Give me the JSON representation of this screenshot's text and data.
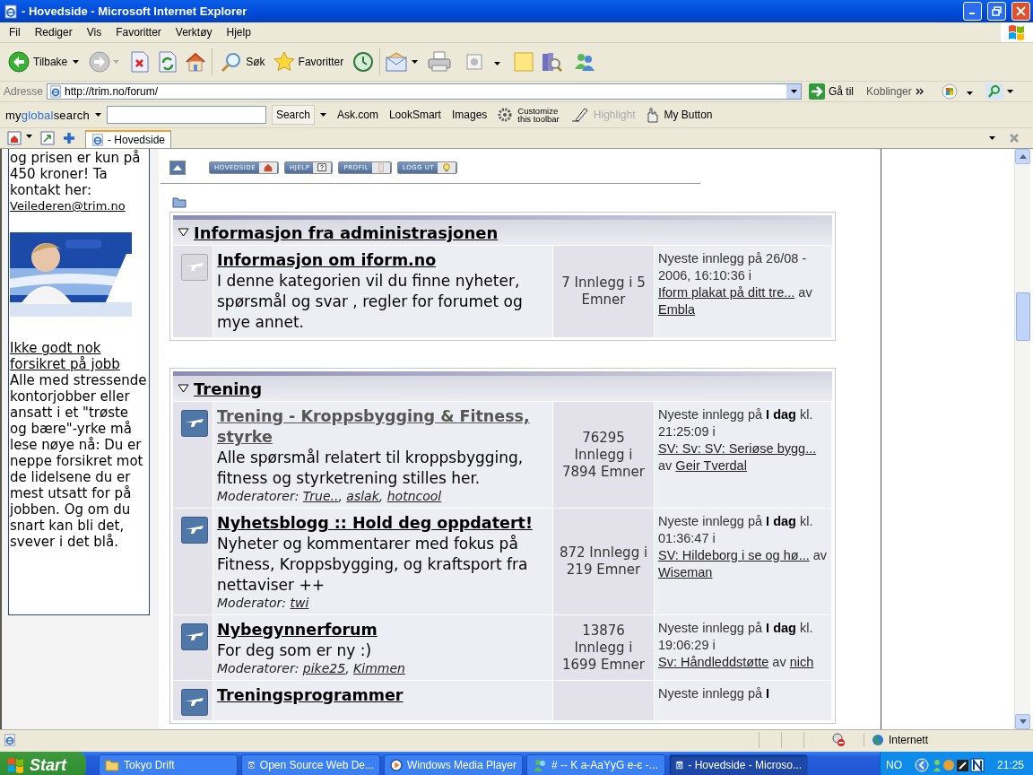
{
  "window": {
    "title": "- Hovedside - Microsoft Internet Explorer"
  },
  "menu": [
    "Fil",
    "Rediger",
    "Vis",
    "Favoritter",
    "Verktøy",
    "Hjelp"
  ],
  "toolbar": {
    "back": "Tilbake",
    "search": "Søk",
    "favorites": "Favoritter"
  },
  "address": {
    "label": "Adresse",
    "value": "http://trim.no/forum/",
    "go": "Gå til",
    "links": "Koblinger"
  },
  "search_toolbar": {
    "brand": [
      "my",
      "global",
      "search"
    ],
    "button": "Search",
    "links": [
      "Ask.com",
      "LookSmart",
      "Images"
    ],
    "customize": [
      "Customize",
      "this toolbar"
    ],
    "highlight": {
      "label": "Highlight",
      "disabled": true
    },
    "my_button": "My Button"
  },
  "tabs": [
    {
      "label": "- Hovedside",
      "selected": true
    }
  ],
  "sidebar": {
    "intro": "og prisen er kun på 450 kroner! Ta kontakt her:",
    "email": "Veilederen@trim.no",
    "article_link": "Ikke godt nok forsikret på jobb",
    "article_text": "Alle med stressende kontorjobber eller ansatt i et \"trøste og bære\"-yrke må lese nøye nå: Du er neppe forsikret mot de lidelsene du er mest utsatt for på jobben. Og om du snart kan bli det, svever i det blå."
  },
  "forum_nav": [
    "HOVEDSIDE",
    "HJELP",
    "PROFIL",
    "LOGG UT"
  ],
  "list_separator": ", ",
  "categories": [
    {
      "title": "Informasjon fra administrasjonen",
      "expanded": true,
      "forums": [
        {
          "title": "Informasjon om iform.no",
          "visited": false,
          "new_posts": false,
          "description": "I denne kategorien vil du finne nyheter, spørsmål og svar , regler for forumet og mye annet.",
          "stats": "7 Innlegg i 5 Emner",
          "last_post": {
            "text": "Nyeste innlegg på 26/08 - 2006, 16:10:36",
            "in_label": "i",
            "topic": "Iform plakat på ditt tre...",
            "by_label": "av",
            "author": "Embla"
          }
        }
      ]
    },
    {
      "title": "Trening",
      "expanded": true,
      "forums": [
        {
          "title": "Trening - Kroppsbygging & Fitness, styrke",
          "visited": true,
          "new_posts": true,
          "description": "Alle spørsmål relatert til kroppsbygging, fitness og styrketrening stilles her.",
          "moderators": {
            "label": "Moderatorer:",
            "names": [
              "True..",
              "aslak",
              "hotncool"
            ]
          },
          "stats": "76295 Innlegg i 7894 Emner",
          "last_post": {
            "text": "Nyeste innlegg på **I dag** kl. 21:25:09",
            "in_label": "i",
            "topic": "SV: Sv: SV: Seriøse bygg...",
            "by_label": "av",
            "author": "Geir Tverdal"
          }
        },
        {
          "title": "Nyhetsblogg :: Hold deg oppdatert!",
          "visited": false,
          "new_posts": true,
          "description": "Nyheter og kommentarer med fokus på Fitness, Kroppsbygging, og kraftsport fra nettaviser ++",
          "moderators": {
            "label": "Moderator:",
            "names": [
              "twi"
            ]
          },
          "stats": "872 Innlegg i 219 Emner",
          "last_post": {
            "text": "Nyeste innlegg på **I dag** kl. 01:36:47",
            "in_label": "i",
            "topic": "SV: Hildeborg i se og hø...",
            "by_label": "av",
            "author": "Wiseman"
          }
        },
        {
          "title": "Nybegynnerforum",
          "visited": false,
          "new_posts": true,
          "description": "For deg som er ny :)",
          "moderators": {
            "label": "Moderatorer:",
            "names": [
              "pike25",
              "Kimmen"
            ]
          },
          "stats": "13876 Innlegg i 1699 Emner",
          "last_post": {
            "text": "Nyeste innlegg på **I dag** kl. 19:06:29",
            "in_label": "i",
            "topic": "Sv: Håndleddstøtte",
            "by_label": "av",
            "author": "nich"
          }
        },
        {
          "title": "Treningsprogrammer",
          "visited": false,
          "new_posts": true,
          "last_post": {
            "text": "Nyeste innlegg på **I**"
          }
        }
      ]
    }
  ],
  "status_bar": {
    "zone": "Internett"
  },
  "taskbar": {
    "start": "Start",
    "tasks": [
      {
        "label": "Tokyo Drift",
        "kind": "folder",
        "selected": false
      },
      {
        "label": "Open Source Web De...",
        "kind": "browser",
        "selected": false
      },
      {
        "label": "Windows Media Player",
        "kind": "media",
        "selected": false
      },
      {
        "label": "# -- K a-AaYyG e-є -...",
        "kind": "chat",
        "selected": false
      },
      {
        "label": "- Hovedside - Microso...",
        "kind": "browser",
        "selected": true
      }
    ],
    "language": "NO",
    "clock": "21:25"
  }
}
